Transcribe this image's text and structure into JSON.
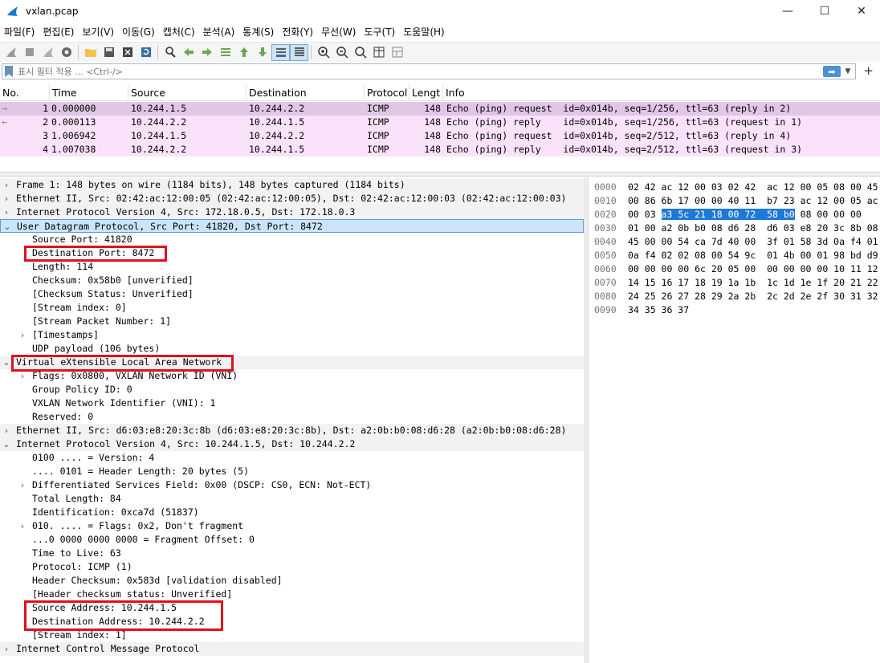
{
  "window": {
    "title": "vxlan.pcap",
    "minimize": "—",
    "maximize": "☐",
    "close": "✕"
  },
  "menu": [
    "파일(F)",
    "편집(E)",
    "보기(V)",
    "이동(G)",
    "캡처(C)",
    "분석(A)",
    "통계(S)",
    "전화(Y)",
    "무선(W)",
    "도구(T)",
    "도움말(H)"
  ],
  "filter": {
    "placeholder": "표시 필터 적용 ... <Ctrl-/>",
    "apply_icon": "arrow-right-icon",
    "plus": "+"
  },
  "packet_list": {
    "columns": [
      "No.",
      "Time",
      "Source",
      "Destination",
      "Protocol",
      "Lengt",
      "Info"
    ],
    "rows": [
      {
        "no": "1",
        "time": "0.000000",
        "src": "10.244.1.5",
        "dst": "10.244.2.2",
        "proto": "ICMP",
        "len": "148",
        "info": "Echo (ping) request  id=0x014b, seq=1/256, ttl=63 (reply in 2)",
        "arrow": "→"
      },
      {
        "no": "2",
        "time": "0.000113",
        "src": "10.244.2.2",
        "dst": "10.244.1.5",
        "proto": "ICMP",
        "len": "148",
        "info": "Echo (ping) reply    id=0x014b, seq=1/256, ttl=63 (request in 1)",
        "arrow": "←"
      },
      {
        "no": "3",
        "time": "1.006942",
        "src": "10.244.1.5",
        "dst": "10.244.2.2",
        "proto": "ICMP",
        "len": "148",
        "info": "Echo (ping) request  id=0x014b, seq=2/512, ttl=63 (reply in 4)",
        "arrow": ""
      },
      {
        "no": "4",
        "time": "1.007038",
        "src": "10.244.2.2",
        "dst": "10.244.1.5",
        "proto": "ICMP",
        "len": "148",
        "info": "Echo (ping) reply    id=0x014b, seq=2/512, ttl=63 (request in 3)",
        "arrow": ""
      }
    ]
  },
  "details": [
    {
      "exp": "›",
      "indent": 0,
      "text": "Frame 1: 148 bytes on wire (1184 bits), 148 bytes captured (1184 bits)"
    },
    {
      "exp": "›",
      "indent": 0,
      "text": "Ethernet II, Src: 02:42:ac:12:00:05 (02:42:ac:12:00:05), Dst: 02:42:ac:12:00:03 (02:42:ac:12:00:03)"
    },
    {
      "exp": "›",
      "indent": 0,
      "text": "Internet Protocol Version 4, Src: 172.18.0.5, Dst: 172.18.0.3"
    },
    {
      "exp": "⌄",
      "indent": 0,
      "text": "User Datagram Protocol, Src Port: 41820, Dst Port: 8472",
      "selected": true
    },
    {
      "exp": "",
      "indent": 1,
      "text": "Source Port: 41820"
    },
    {
      "exp": "",
      "indent": 1,
      "text": "Destination Port: 8472"
    },
    {
      "exp": "",
      "indent": 1,
      "text": "Length: 114"
    },
    {
      "exp": "",
      "indent": 1,
      "text": "Checksum: 0x58b0 [unverified]"
    },
    {
      "exp": "",
      "indent": 1,
      "text": "[Checksum Status: Unverified]"
    },
    {
      "exp": "",
      "indent": 1,
      "text": "[Stream index: 0]"
    },
    {
      "exp": "",
      "indent": 1,
      "text": "[Stream Packet Number: 1]"
    },
    {
      "exp": "›",
      "indent": 1,
      "text": "[Timestamps]"
    },
    {
      "exp": "",
      "indent": 1,
      "text": "UDP payload (106 bytes)"
    },
    {
      "exp": "⌄",
      "indent": 0,
      "text": "Virtual eXtensible Local Area Network"
    },
    {
      "exp": "›",
      "indent": 1,
      "text": "Flags: 0x0800, VXLAN Network ID (VNI)"
    },
    {
      "exp": "",
      "indent": 1,
      "text": "Group Policy ID: 0"
    },
    {
      "exp": "",
      "indent": 1,
      "text": "VXLAN Network Identifier (VNI): 1"
    },
    {
      "exp": "",
      "indent": 1,
      "text": "Reserved: 0"
    },
    {
      "exp": "›",
      "indent": 0,
      "text": "Ethernet II, Src: d6:03:e8:20:3c:8b (d6:03:e8:20:3c:8b), Dst: a2:0b:b0:08:d6:28 (a2:0b:b0:08:d6:28)"
    },
    {
      "exp": "⌄",
      "indent": 0,
      "text": "Internet Protocol Version 4, Src: 10.244.1.5, Dst: 10.244.2.2"
    },
    {
      "exp": "",
      "indent": 1,
      "text": "0100 .... = Version: 4"
    },
    {
      "exp": "",
      "indent": 1,
      "text": ".... 0101 = Header Length: 20 bytes (5)"
    },
    {
      "exp": "›",
      "indent": 1,
      "text": "Differentiated Services Field: 0x00 (DSCP: CS0, ECN: Not-ECT)"
    },
    {
      "exp": "",
      "indent": 1,
      "text": "Total Length: 84"
    },
    {
      "exp": "",
      "indent": 1,
      "text": "Identification: 0xca7d (51837)"
    },
    {
      "exp": "›",
      "indent": 1,
      "text": "010. .... = Flags: 0x2, Don't fragment"
    },
    {
      "exp": "",
      "indent": 1,
      "text": "...0 0000 0000 0000 = Fragment Offset: 0"
    },
    {
      "exp": "",
      "indent": 1,
      "text": "Time to Live: 63"
    },
    {
      "exp": "",
      "indent": 1,
      "text": "Protocol: ICMP (1)"
    },
    {
      "exp": "",
      "indent": 1,
      "text": "Header Checksum: 0x583d [validation disabled]"
    },
    {
      "exp": "",
      "indent": 1,
      "text": "[Header checksum status: Unverified]"
    },
    {
      "exp": "",
      "indent": 1,
      "text": "Source Address: 10.244.1.5"
    },
    {
      "exp": "",
      "indent": 1,
      "text": "Destination Address: 10.244.2.2"
    },
    {
      "exp": "",
      "indent": 1,
      "text": "[Stream index: 1]"
    },
    {
      "exp": "›",
      "indent": 0,
      "text": "Internet Control Message Protocol"
    }
  ],
  "bytes": [
    {
      "off": "0000",
      "hex": "02 42 ac 12 00 03 02 42  ac 12 00 05 08 00 45"
    },
    {
      "off": "0010",
      "hex": "00 86 6b 17 00 00 40 11  b7 23 ac 12 00 05 ac"
    },
    {
      "off": "0020",
      "pre": "00 03 ",
      "hl": "a3 5c 21 18 00 72  58 b0",
      "post": " 08 00 00 00"
    },
    {
      "off": "0030",
      "hex": "01 00 a2 0b b0 08 d6 28  d6 03 e8 20 3c 8b 08"
    },
    {
      "off": "0040",
      "hex": "45 00 00 54 ca 7d 40 00  3f 01 58 3d 0a f4 01"
    },
    {
      "off": "0050",
      "hex": "0a f4 02 02 08 00 54 9c  01 4b 00 01 98 bd d9"
    },
    {
      "off": "0060",
      "hex": "00 00 00 00 6c 20 05 00  00 00 00 00 10 11 12"
    },
    {
      "off": "0070",
      "hex": "14 15 16 17 18 19 1a 1b  1c 1d 1e 1f 20 21 22"
    },
    {
      "off": "0080",
      "hex": "24 25 26 27 28 29 2a 2b  2c 2d 2e 2f 30 31 32"
    },
    {
      "off": "0090",
      "hex": "34 35 36 37"
    }
  ],
  "toolbar_icons": [
    "shark-fin-start-icon",
    "stop-icon",
    "restart-icon",
    "options-gear-icon",
    "open-folder-icon",
    "save-file-icon",
    "close-file-icon",
    "reload-icon",
    "find-icon",
    "go-back-icon",
    "go-forward-icon",
    "go-to-packet-icon",
    "first-packet-icon",
    "last-packet-icon",
    "autoscroll-icon",
    "colorize-icon",
    "zoom-in-icon",
    "zoom-out-icon",
    "zoom-reset-icon",
    "resize-columns-icon",
    "layout-icon"
  ],
  "colors": {
    "row_bg": "#fbe2fb",
    "row_selected": "#e1c6e6",
    "detail_selected": "#cce4f7",
    "hex_highlight": "#1e78d7",
    "annotation_red": "#e0101c"
  }
}
